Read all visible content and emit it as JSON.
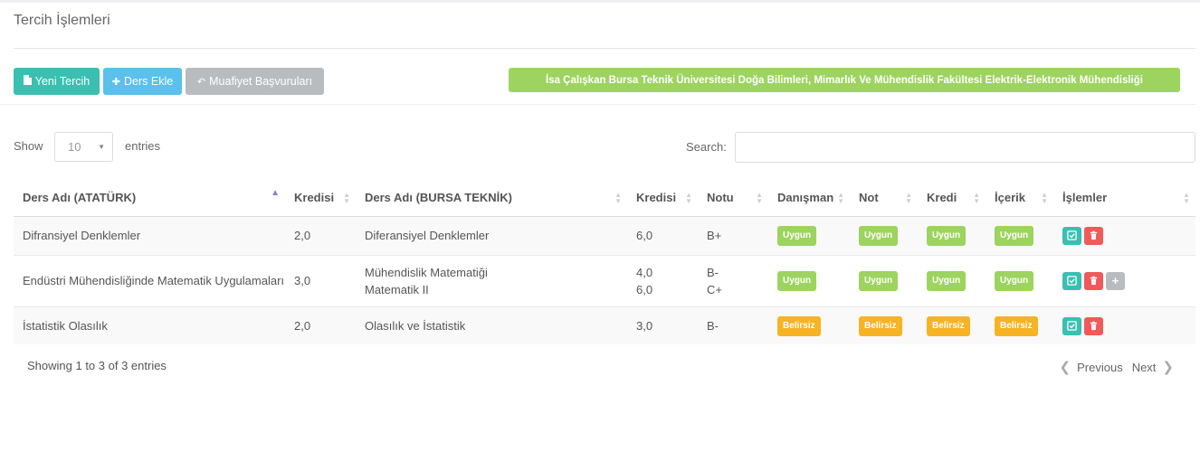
{
  "page": {
    "title": "Tercih İşlemleri"
  },
  "toolbar": {
    "new_choice": "Yeni Tercih",
    "add_course": "Ders Ekle",
    "exemption": "Muafiyet Başvuruları",
    "program_badge": "İsa Çalışkan Bursa Teknik Üniversitesi Doğa Bilimleri, Mimarlık Ve Mühendislik Fakültesi Elektrik-Elektronik Mühendisliği"
  },
  "controls": {
    "show_label": "Show",
    "length_value": "10",
    "entries_label": "entries",
    "search_label": "Search:",
    "search_value": ""
  },
  "table": {
    "headers": [
      "Ders Adı (ATATÜRK)",
      "Kredisi",
      "Ders Adı (BURSA TEKNİK)",
      "Kredisi",
      "Notu",
      "Danışman",
      "Not",
      "Kredi",
      "İçerik",
      "İşlemler"
    ],
    "rows": [
      {
        "course_src": "Difransiyel Denklemler",
        "credit_src": "2,0",
        "course_dst_1": "Diferansiyel Denklemler",
        "course_dst_2": "",
        "credit_dst_1": "6,0",
        "credit_dst_2": "",
        "grade_1": "B+",
        "grade_2": "",
        "advisor": "Uygun",
        "note": "Uygun",
        "credit": "Uygun",
        "content": "Uygun"
      },
      {
        "course_src": "Endüstri Mühendisliğinde Matematik Uygulamaları",
        "credit_src": "3,0",
        "course_dst_1": "Mühendislik Matematiği",
        "course_dst_2": "Matematik II",
        "credit_dst_1": "4,0",
        "credit_dst_2": "6,0",
        "grade_1": "B-",
        "grade_2": "C+",
        "advisor": "Uygun",
        "note": "Uygun",
        "credit": "Uygun",
        "content": "Uygun"
      },
      {
        "course_src": "İstatistik Olasılık",
        "credit_src": "2,0",
        "course_dst_1": "Olasılık ve İstatistik",
        "course_dst_2": "",
        "credit_dst_1": "3,0",
        "credit_dst_2": "",
        "grade_1": "B-",
        "grade_2": "",
        "advisor": "Belirsiz",
        "note": "Belirsiz",
        "credit": "Belirsiz",
        "content": "Belirsiz"
      }
    ]
  },
  "footer": {
    "info": "Showing 1 to 3 of 3 entries",
    "previous": "Previous",
    "next": "Next"
  },
  "colors": {
    "teal": "#3bbfb0",
    "blue": "#5bc0eb",
    "gray": "#b9bcbf",
    "green": "#9dd35f",
    "orange": "#f6b323",
    "red": "#f05a5a"
  },
  "icons": {
    "new_choice": "file-icon",
    "add_course": "plus-icon",
    "exemption": "reply-icon",
    "edit": "edit-check-icon",
    "delete": "trash-icon",
    "add": "plus-icon"
  }
}
